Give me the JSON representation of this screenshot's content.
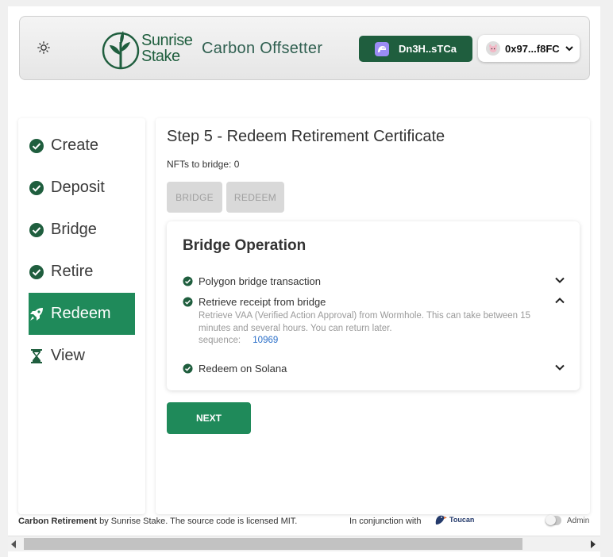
{
  "header": {
    "logo_text_line1": "Sunrise",
    "logo_text_line2": "Stake",
    "app_title": "Carbon Offsetter",
    "wallet_label": "Dn3H..sTCa",
    "evm_address": "0x97...f8FC"
  },
  "sidebar": {
    "items": [
      {
        "label": "Create",
        "icon": "check-circle-icon",
        "active": false
      },
      {
        "label": "Deposit",
        "icon": "check-circle-icon",
        "active": false
      },
      {
        "label": "Bridge",
        "icon": "check-circle-icon",
        "active": false
      },
      {
        "label": "Retire",
        "icon": "check-circle-icon",
        "active": false
      },
      {
        "label": "Redeem",
        "icon": "rocket-icon",
        "active": true
      },
      {
        "label": "View",
        "icon": "hourglass-icon",
        "active": false
      }
    ]
  },
  "main": {
    "step_title": "Step 5 - Redeem Retirement Certificate",
    "nft_count": "NFTs to bridge: 0",
    "bridge_button": "BRIDGE",
    "redeem_button": "REDEEM",
    "next_button": "NEXT"
  },
  "bridge_operation": {
    "title": "Bridge Operation",
    "steps": [
      {
        "label": "Polygon bridge transaction",
        "expanded": false
      },
      {
        "label": "Retrieve receipt from bridge",
        "expanded": true
      },
      {
        "label": "Redeem on Solana",
        "expanded": false
      }
    ],
    "description": "Retrieve VAA (Verified Action Approval) from Wormhole. This can take between 15 minutes and several hours. You can return later.",
    "sequence_label": "sequence:",
    "sequence_value": "10969"
  },
  "footer": {
    "credit_bold": "Carbon Retirement",
    "credit_rest": " by Sunrise Stake. The source code is licensed MIT.",
    "conjunction": "In conjunction with",
    "partner": "Toucan",
    "admin_label": "Admin",
    "admin_enabled": false
  },
  "colors": {
    "brand_green": "#1f5e3e",
    "active_green": "#1f8a5a",
    "link_blue": "#2a6fc9"
  }
}
